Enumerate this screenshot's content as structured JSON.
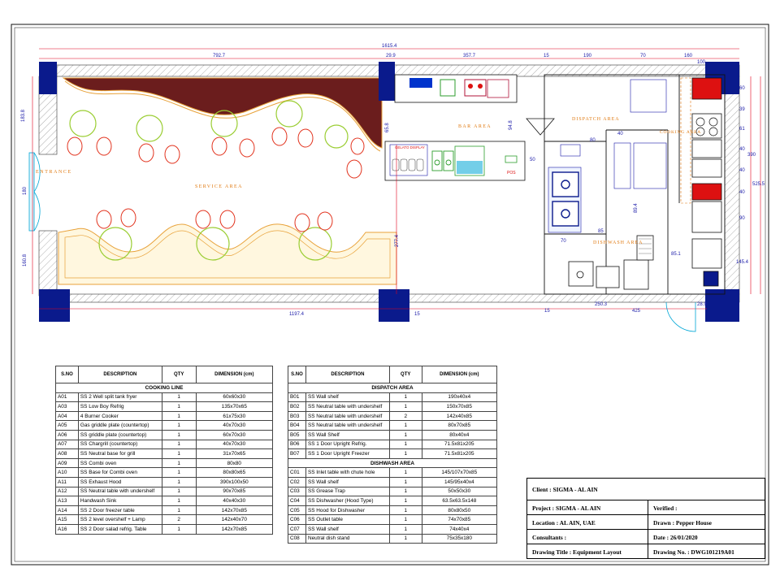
{
  "plan": {
    "area_labels": {
      "entrance": "ENTRANCE",
      "service_area": "SERVICE AREA",
      "bar_area": "BAR AREA",
      "dispatch_area": "DISPATCH AREA",
      "dishwash_area": "DISHWASH AREA",
      "cooking_area": "COOKING AREA",
      "gelato_display": "GELATO DISPLAY",
      "pos": "POS"
    },
    "dimensions": {
      "overall_top": "1615.4",
      "top_792": "792.7",
      "top_29": "29.9",
      "top_357": "357.7",
      "top_15": "15",
      "top_190": "190",
      "top_70": "70",
      "top_160": "160",
      "top_100": "100",
      "left_183": "183.8",
      "left_180": "180",
      "left_160": "160.8",
      "bottom_1197": "1197.4",
      "bottom_15a": "15",
      "bottom_250": "250.3",
      "bottom_15b": "15",
      "bottom_425": "425",
      "bottom_28": "28.9",
      "right_60": "60",
      "right_39": "39",
      "right_61": "61",
      "right_40a": "40",
      "right_390": "390",
      "right_40b": "40",
      "right_525": "525.5",
      "right_40c": "40",
      "right_90": "90",
      "right_145": "145.4",
      "mid_65": "65.8",
      "mid_94": "94.8",
      "mid_50": "50",
      "mid_277": "277.4",
      "mid_80": "80",
      "mid_40": "40",
      "mid_89": "89.4",
      "mid_85": "85",
      "mid_70": "70",
      "mid_85b": "85.1"
    }
  },
  "table_left": {
    "headers": {
      "sno": "S.NO",
      "desc": "DESCRIPTION",
      "qty": "QTY",
      "dim": "DIMENSION (cm)"
    },
    "section": "COOKING LINE",
    "rows": [
      [
        "A01",
        "SS 2 Well split tank fryer",
        "1",
        "60x60x30"
      ],
      [
        "A03",
        "SS Low Boy Refrig",
        "1",
        "135x70x65"
      ],
      [
        "A04",
        "4 Burner Cooker",
        "1",
        "61x75x30"
      ],
      [
        "A05",
        "Gas griddle plate (countertop)",
        "1",
        "40x70x30"
      ],
      [
        "A06",
        "SS griddle plate (countertop)",
        "1",
        "60x70x30"
      ],
      [
        "A07",
        "SS Chargrill (countertop)",
        "1",
        "40x70x30"
      ],
      [
        "A08",
        "SS Neutral base for grill",
        "1",
        "31x70x65"
      ],
      [
        "A09",
        "SS Combi oven",
        "1",
        "80x80"
      ],
      [
        "A10",
        "SS Base for Combi oven",
        "1",
        "80x80x65"
      ],
      [
        "A11",
        "SS Exhaust Hood",
        "1",
        "390x100x50"
      ],
      [
        "A12",
        "SS Neutral table with undershelf",
        "1",
        "90x70x85"
      ],
      [
        "A13",
        "Handwash Sink",
        "1",
        "40x40x30"
      ],
      [
        "A14",
        "SS 2 Door freezer table",
        "1",
        "142x70x85"
      ],
      [
        "A15",
        "SS 2 level overshelf + Lamp",
        "2",
        "142x40x70"
      ],
      [
        "A16",
        "SS 2 Door salad refrig. Table",
        "1",
        "142x70x85"
      ]
    ]
  },
  "table_right": {
    "headers": {
      "sno": "S.NO",
      "desc": "DESCRIPTION",
      "qty": "QTY",
      "dim": "DIMENSION (cm)"
    },
    "section1": "DISPATCH AREA",
    "rows1": [
      [
        "B01",
        "SS Wall shelf",
        "1",
        "190x40x4"
      ],
      [
        "B02",
        "SS Neutral table with undershelf",
        "1",
        "150x70x85"
      ],
      [
        "B03",
        "SS Neutral table with undershelf",
        "2",
        "142x40x85"
      ],
      [
        "B04",
        "SS Neutral table with undershelf",
        "1",
        "80x70x85"
      ],
      [
        "B05",
        "SS Wall Shelf",
        "1",
        "80x40x4"
      ],
      [
        "B06",
        "SS 1 Door Upright Refrig.",
        "1",
        "71.5x81x205"
      ],
      [
        "B07",
        "SS 1 Door Upright Freezer",
        "1",
        "71.5x81x205"
      ]
    ],
    "section2": "DISHWASH AREA",
    "rows2": [
      [
        "C01",
        "SS Inlet table with chute hole",
        "1",
        "145/107x70x85"
      ],
      [
        "C02",
        "SS Wall shelf",
        "1",
        "145/95x40x4"
      ],
      [
        "C03",
        "SS Grease Trap",
        "1",
        "50x50x30"
      ],
      [
        "C04",
        "SS Dishwasher (Hood Type)",
        "1",
        "63.5x63.5x148"
      ],
      [
        "C05",
        "SS Hood for Dishwasher",
        "1",
        "80x80x50"
      ],
      [
        "C06",
        "SS Outlet table",
        "1",
        "74x70x85"
      ],
      [
        "C07",
        "SS Wall shelf",
        "1",
        "74x40x4"
      ],
      [
        "C08",
        "Neutral dish stand",
        "1",
        "75x35x180"
      ]
    ]
  },
  "title_block": {
    "client": "Client : SIGMA - AL AIN",
    "project": "Project : SIGMA - AL AIN",
    "verified": "Verified :",
    "location": "Location : AL AIN, UAE",
    "drawn": "Drawn : Pepper House",
    "consultants": "Consultants :",
    "date": "Date : 26/01/2020",
    "drawing_title": "Drawing Title : Equipment Layout",
    "drawing_no": "Drawing No. : DWG101219A01"
  },
  "colors": {
    "dim_line": "#e0001b",
    "dim_text": "#1a1aa8",
    "column": "#0a1a8c",
    "wood": "#6b1d1d",
    "chair": "#e2341f",
    "table_ring": "#9acd32",
    "counter": "#e8a23a",
    "area_text": "#e07a12"
  }
}
